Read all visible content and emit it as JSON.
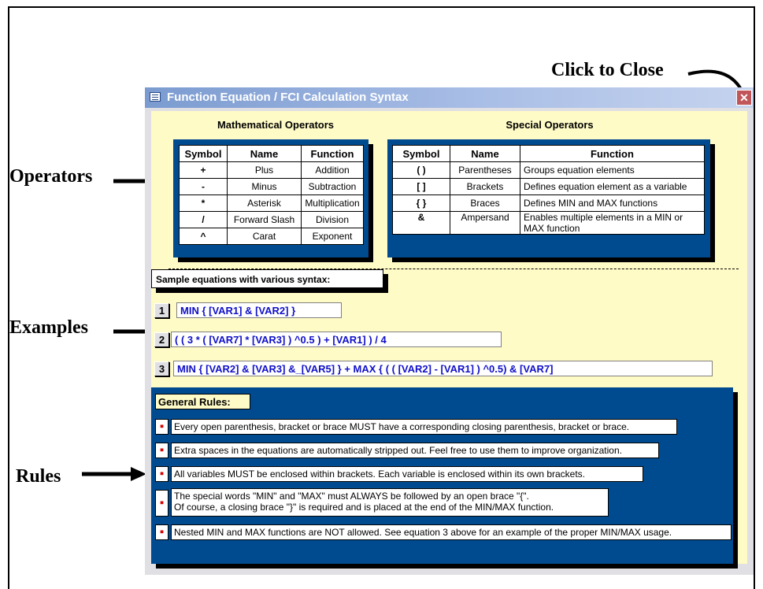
{
  "annotations": {
    "click_to_close": "Click to Close",
    "operators": "Operators",
    "examples": "Examples",
    "rules": "Rules"
  },
  "window": {
    "title": "Function Equation / FCI Calculation Syntax",
    "close_icon": "x-icon"
  },
  "math_operators": {
    "heading": "Mathematical Operators",
    "columns": [
      "Symbol",
      "Name",
      "Function"
    ],
    "rows": [
      [
        "+",
        "Plus",
        "Addition"
      ],
      [
        "-",
        "Minus",
        "Subtraction"
      ],
      [
        "*",
        "Asterisk",
        "Multiplication"
      ],
      [
        "/",
        "Forward Slash",
        "Division"
      ],
      [
        "^",
        "Carat",
        "Exponent"
      ]
    ]
  },
  "special_operators": {
    "heading": "Special Operators",
    "columns": [
      "Symbol",
      "Name",
      "Function"
    ],
    "rows": [
      [
        "( )",
        "Parentheses",
        "Groups equation elements"
      ],
      [
        "[ ]",
        "Brackets",
        "Defines equation element as a variable"
      ],
      [
        "{ }",
        "Braces",
        "Defines MIN and MAX functions"
      ],
      [
        "&",
        "Ampersand",
        "Enables multiple elements in a MIN or MAX function"
      ]
    ]
  },
  "samples": {
    "label": "Sample equations with various syntax:",
    "items": [
      {
        "num": "1",
        "equation": "MIN { [VAR1]  &  [VAR2] }"
      },
      {
        "num": "2",
        "equation": "( ( 3 * ( [VAR7] * [VAR3] ) ^0.5 ) + [VAR1] ) / 4"
      },
      {
        "num": "3",
        "equation": "MIN { [VAR2]  &  [VAR3]  &_[VAR5] } + MAX { ( ( [VAR2] - [VAR1] ) ^0.5)  &  [VAR7]"
      }
    ]
  },
  "rules": {
    "title": "General Rules:",
    "bullet": "▪",
    "items": [
      {
        "line1": "Every open parenthesis, bracket or brace MUST have a corresponding closing parenthesis, bracket or brace.",
        "line2": ""
      },
      {
        "line1": "Extra spaces in the equations are automatically stripped out. Feel free to use them to improve organization.",
        "line2": ""
      },
      {
        "line1": "All variables MUST be enclosed within brackets. Each variable is enclosed within its own brackets.",
        "line2": ""
      },
      {
        "line1": "The special words \"MIN\" and \"MAX\" must ALWAYS be followed by an open brace \"{\".",
        "line2": "Of course, a closing brace \"}\" is required and is placed at the end of the MIN/MAX function."
      },
      {
        "line1": "Nested MIN and MAX functions are NOT allowed. See equation 3 above for an example of the proper MIN/MAX usage.",
        "line2": ""
      }
    ]
  }
}
